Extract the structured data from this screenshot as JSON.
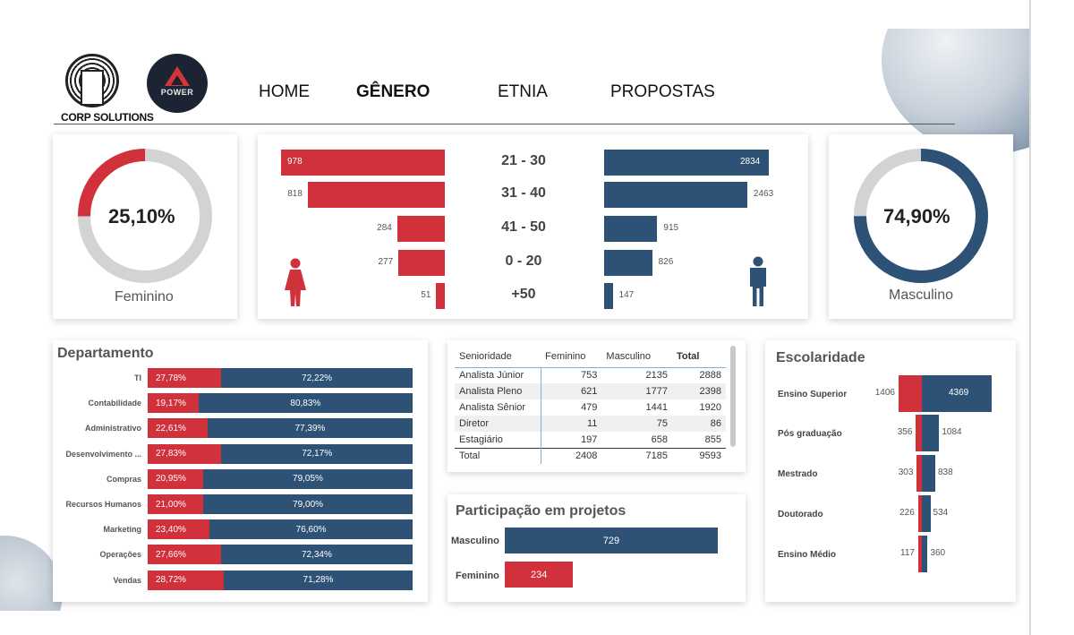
{
  "header": {
    "logo1_text": "CORP SOLUTIONS",
    "logo2_text": "POWER",
    "nav": [
      "HOME",
      "GÊNERO",
      "ETNIA",
      "PROPOSTAS"
    ]
  },
  "gender_donuts": {
    "female": {
      "value": "25,10%",
      "label": "Feminino",
      "fraction": 0.251
    },
    "male": {
      "value": "74,90%",
      "label": "Masculino",
      "fraction": 0.749
    }
  },
  "age": {
    "groups": [
      "21 - 30",
      "31 - 40",
      "41 - 50",
      "0 - 20",
      "+50"
    ],
    "female": [
      "978",
      "818",
      "284",
      "277",
      "51"
    ],
    "male": [
      "2834",
      "2463",
      "915",
      "826",
      "147"
    ]
  },
  "departamento": {
    "title": "Departamento",
    "rows": [
      {
        "name": "TI",
        "f": "27,78%",
        "m": "72,22%",
        "fv": 27.78
      },
      {
        "name": "Contabilidade",
        "f": "19,17%",
        "m": "80,83%",
        "fv": 19.17
      },
      {
        "name": "Administrativo",
        "f": "22,61%",
        "m": "77,39%",
        "fv": 22.61
      },
      {
        "name": "Desenvolvimento ...",
        "f": "27,83%",
        "m": "72,17%",
        "fv": 27.83
      },
      {
        "name": "Compras",
        "f": "20,95%",
        "m": "79,05%",
        "fv": 20.95
      },
      {
        "name": "Recursos Humanos",
        "f": "21,00%",
        "m": "79,00%",
        "fv": 21.0
      },
      {
        "name": "Marketing",
        "f": "23,40%",
        "m": "76,60%",
        "fv": 23.4
      },
      {
        "name": "Operações",
        "f": "27,66%",
        "m": "72,34%",
        "fv": 27.66
      },
      {
        "name": "Vendas",
        "f": "28,72%",
        "m": "71,28%",
        "fv": 28.72
      }
    ]
  },
  "senioridade": {
    "headers": [
      "Senioridade",
      "Feminino",
      "Masculino",
      "Total"
    ],
    "rows": [
      [
        "Analista Júnior",
        "753",
        "2135",
        "2888"
      ],
      [
        "Analista Pleno",
        "621",
        "1777",
        "2398"
      ],
      [
        "Analista Sênior",
        "479",
        "1441",
        "1920"
      ],
      [
        "Diretor",
        "11",
        "75",
        "86"
      ],
      [
        "Estagiário",
        "197",
        "658",
        "855"
      ]
    ],
    "total": [
      "Total",
      "2408",
      "7185",
      "9593"
    ]
  },
  "projetos": {
    "title": "Participação em projetos",
    "male_label": "Masculino",
    "male_value": "729",
    "female_label": "Feminino",
    "female_value": "234"
  },
  "escolaridade": {
    "title": "Escolaridade",
    "rows": [
      {
        "name": "Ensino Superior",
        "f": "1406",
        "m": "4369"
      },
      {
        "name": "Pós graduação",
        "f": "356",
        "m": "1084"
      },
      {
        "name": "Mestrado",
        "f": "303",
        "m": "838"
      },
      {
        "name": "Doutorado",
        "f": "226",
        "m": "534"
      },
      {
        "name": "Ensino Médio",
        "f": "117",
        "m": "360"
      }
    ]
  },
  "colors": {
    "female": "#d0313a",
    "male": "#2d5276",
    "gray": "#d3d3d3"
  }
}
